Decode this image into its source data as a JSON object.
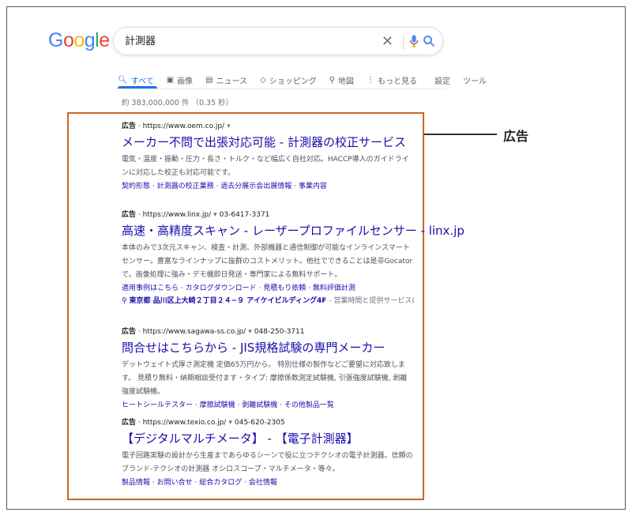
{
  "logo": {
    "letters": [
      "G",
      "o",
      "o",
      "g",
      "l",
      "e"
    ],
    "colors": [
      "#4285f4",
      "#ea4335",
      "#fbbc05",
      "#4285f4",
      "#34a853",
      "#ea4335"
    ]
  },
  "search": {
    "value": "計測器",
    "clear_icon": "close-icon",
    "mic_icon": "mic-icon",
    "search_icon": "search-icon"
  },
  "tabs": [
    {
      "label": "すべて",
      "icon": "search-icon",
      "glyph": "🔍︎"
    },
    {
      "label": "画像",
      "icon": "image-icon",
      "glyph": "▣"
    },
    {
      "label": "ニュース",
      "icon": "news-icon",
      "glyph": "▤"
    },
    {
      "label": "ショッピング",
      "icon": "tag-icon",
      "glyph": "◇"
    },
    {
      "label": "地図",
      "icon": "map-pin-icon",
      "glyph": "⚲"
    },
    {
      "label": "もっと見る",
      "icon": "more-vert-icon",
      "glyph": "⋮"
    },
    {
      "label": "設定"
    },
    {
      "label": "ツール"
    }
  ],
  "stats": "約 383,000,000 件 （0.35 秒）",
  "callout": "広告",
  "colors": {
    "accent": "#1a73e8",
    "link": "#1a0dab",
    "highlight_box": "#c8662b"
  },
  "ads": [
    {
      "badge": "広告",
      "url": "https://www.oem.co.jp/",
      "phone": "",
      "title": "メーカー不問で出張対応可能 - 計測器の校正サービス",
      "desc": "電気・温度・振動・圧力・長さ・トルク・など幅広く自社対応。HACCP導入のガイドラインに対応した校正も対応可能です。",
      "links": [
        "契約形態",
        "計測器の校正業務",
        "過去分展示会出展情報",
        "事業内容"
      ]
    },
    {
      "badge": "広告",
      "url": "https://www.linx.jp/",
      "phone": "03-6417-3371",
      "title": "高速・高精度スキャン - レーザープロファイルセンサー - linx.jp",
      "desc": "本体のみで3次元スキャン、検査・計測、外部機器と通信制御が可能なインラインスマートセンサー。豊富なラインナップに抜群のコストメリット。他社でできることは是非Gocatorで。画像処理に強み・デモ機即日発送・専門家による無料サポート。",
      "links": [
        "適用事例はこちら",
        "カタログダウンロード",
        "見積もり依頼",
        "無料評価計測"
      ],
      "location": "東京都 品川区上大崎２丁目２４−９ アイケイビルディング4F",
      "location_extra": " - 営業時間と提供サービスは..."
    },
    {
      "badge": "広告",
      "url": "https://www.sagawa-ss.co.jp/",
      "phone": "048-250-3711",
      "title": "問合せはこちらから - JIS規格試験の専門メーカー",
      "desc": "デットウェイト式厚さ測定機 定価65万円から。 特別仕様の製作などご要望に対応致します。 見積り無料・納期相談受付ます・タイプ: 摩擦係数測定試験機, 引張強度試験機, 剥離強度試験機。",
      "links": [
        "ヒートシールテスター",
        "摩擦試験機",
        "剥離試験機",
        "その他製品一覧"
      ]
    },
    {
      "badge": "広告",
      "url": "https://www.texio.co.jp/",
      "phone": "045-620-2305",
      "title": "【デジタルマルチメータ】 - 【電子計測器】",
      "desc": "電子回路実験の設計から生産まであらゆるシーンで役に立つテクシオの電子計測器。信頼のブランド-テクシオの計測器 オシロスコープ・マルチメータ・等々。",
      "links": [
        "製品情報",
        "お問い合せ",
        "総合カタログ",
        "会社情報"
      ]
    }
  ]
}
